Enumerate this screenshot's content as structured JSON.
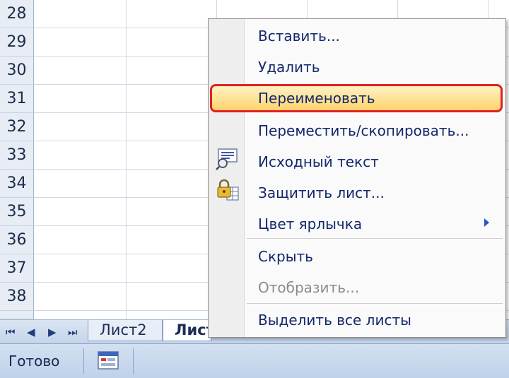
{
  "rows": [
    "28",
    "29",
    "30",
    "31",
    "32",
    "33",
    "34",
    "35",
    "36",
    "37",
    "38"
  ],
  "sheet_nav": {
    "first": "⏮",
    "prev": "◀",
    "next": "▶",
    "last": "⏭"
  },
  "sheet_tabs": [
    {
      "label": "Лист2"
    },
    {
      "label": "Лист"
    }
  ],
  "context_menu": {
    "items": [
      {
        "label": "Вставить..."
      },
      {
        "label": "Удалить"
      },
      {
        "label": "Переименовать"
      },
      {
        "label": "Переместить/скопировать..."
      },
      {
        "label": "Исходный текст"
      },
      {
        "label": "Защитить лист..."
      },
      {
        "label": "Цвет ярлычка"
      },
      {
        "label": "Скрыть"
      },
      {
        "label": "Отобразить..."
      },
      {
        "label": "Выделить все листы"
      }
    ],
    "highlight_color": "#e02020"
  },
  "status_bar": {
    "text": "Готово"
  }
}
